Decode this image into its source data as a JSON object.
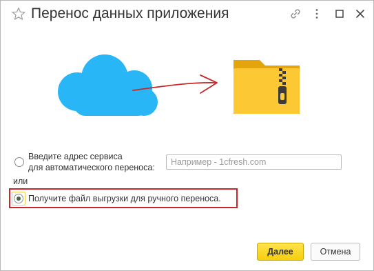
{
  "window": {
    "title": "Перенос данных приложения",
    "icons": [
      "star-icon",
      "link-icon",
      "more-icon",
      "maximize-icon",
      "close-icon"
    ]
  },
  "options": {
    "auto": {
      "line1": "Введите адрес сервиса",
      "line2": "для автоматического переноса:",
      "selected": false
    },
    "input_placeholder": "Например - 1cfresh.com",
    "or_label": "или",
    "manual": {
      "label": "Получите файл выгрузки для ручного переноса.",
      "selected": true
    }
  },
  "buttons": {
    "next": "Далее",
    "cancel": "Отмена"
  },
  "colors": {
    "cloud": "#29b6f6",
    "folder": "#fbc02d",
    "arrow": "#c62828",
    "highlight": "#c9252c",
    "primary_button": "#f5cf0e"
  }
}
